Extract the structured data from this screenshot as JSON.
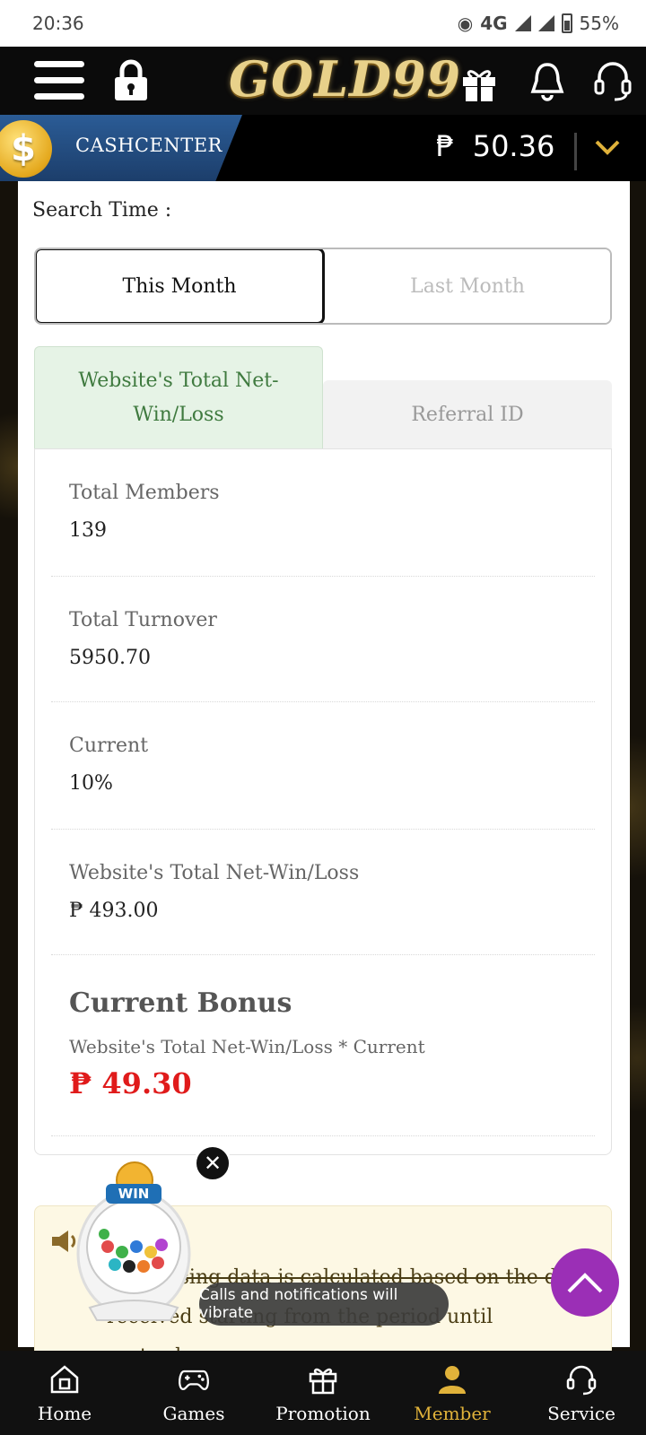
{
  "status_bar": {
    "time": "20:36",
    "network": "4G",
    "battery": "55%"
  },
  "header": {
    "logo": "GOLD99"
  },
  "cash_bar": {
    "label": "CASHCENTER",
    "currency_symbol": "₱",
    "balance": "50.36"
  },
  "search": {
    "label": "Search Time :"
  },
  "period_tabs": {
    "this_month": "This Month",
    "last_month": "Last Month"
  },
  "report_tabs": {
    "net_winloss": "Website's Total Net-Win/Loss",
    "referral_id": "Referral ID"
  },
  "stats": [
    {
      "label": "Total Members",
      "value": "139"
    },
    {
      "label": "Total Turnover",
      "value": "5950.70"
    },
    {
      "label": "Current",
      "value": "10%"
    },
    {
      "label": "Website's Total Net-Win/Loss",
      "value": "₱ 493.00"
    }
  ],
  "bonus": {
    "title": "Current Bonus",
    "formula": "Website's Total Net-Win/Loss * Current",
    "value": "₱ 49.30"
  },
  "note": {
    "line1": "cessing data is calculated based on the dat",
    "line2": "received starting from the period until yesterday."
  },
  "floating": {
    "win_label": "WIN",
    "toast": "Calls and notifications will vibrate"
  },
  "bottom_nav": [
    {
      "label": "Home",
      "icon": "home-icon"
    },
    {
      "label": "Games",
      "icon": "gamepad-icon"
    },
    {
      "label": "Promotion",
      "icon": "gift-icon"
    },
    {
      "label": "Member",
      "icon": "member-icon"
    },
    {
      "label": "Service",
      "icon": "headset-icon"
    }
  ],
  "colors": {
    "accent_gold": "#e0b23a",
    "bonus_red": "#e01b1b",
    "scroll_purple": "#9b2fb6",
    "tab_green": "#3f7a3f"
  }
}
